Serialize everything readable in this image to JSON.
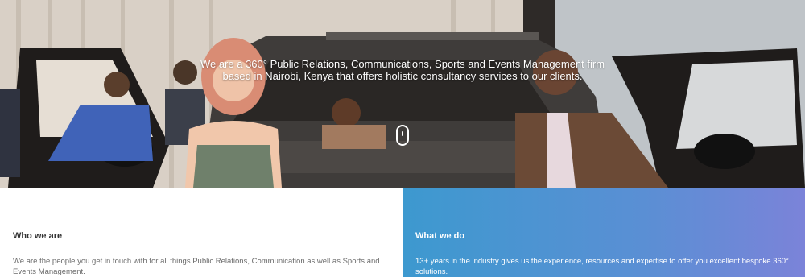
{
  "hero": {
    "line1": "We are a 360° Public Relations, Communications, Sports and Events Management firm",
    "line2": "based in Nairobi, Kenya that offers holistic consultancy services to our clients."
  },
  "who": {
    "title": "Who we are",
    "text": "We are the people you get in touch with for all things Public Relations, Communication as well as Sports and Events Management."
  },
  "what": {
    "title": "What we do",
    "text": "13+ years in the industry gives us the experience, resources and expertise to offer you excellent bespoke 360° solutions."
  },
  "colors": {
    "accent_start": "#3d99cf",
    "accent_end": "#7b83d9"
  }
}
